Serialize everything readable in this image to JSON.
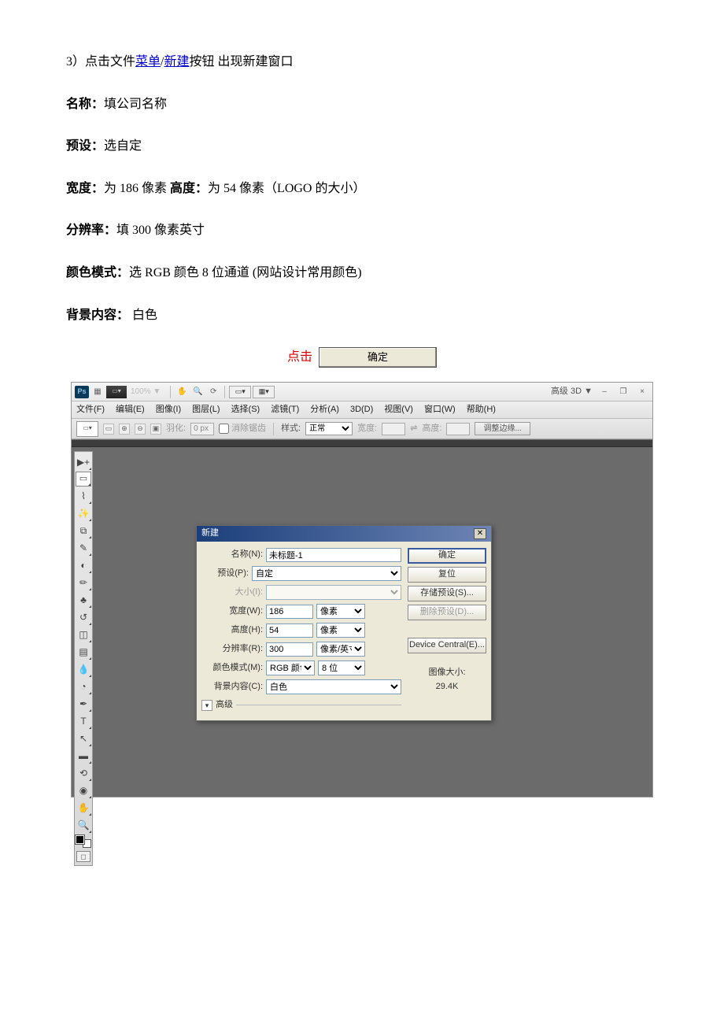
{
  "doc": {
    "step3_prefix": "3）点击文件",
    "menu_link": "菜单",
    "slash": "/",
    "new_link": "新建",
    "step3_suffix": "按钮  出现新建窗口",
    "name_label": "名称：",
    "name_value": "填公司名称",
    "preset_label": "预设：",
    "preset_value": "选自定",
    "width_label": "宽度：",
    "width_value": "为 186 像素  ",
    "height_label": "高度：",
    "height_value": "为 54 像素（LOGO 的大小）",
    "res_label": "分辨率：",
    "res_value": "填 300 像素英寸",
    "color_label": "颜色模式：",
    "color_value": "选 RGB 颜色  8 位通道  (网站设计常用颜色)",
    "bg_label": "背景内容：",
    "bg_value": "   白色",
    "click_text": "点击",
    "ok_demo_label": "确定"
  },
  "ps": {
    "logo": "Ps",
    "zoom": "100% ▼",
    "advanced_3d": "高级 3D ▼",
    "menus": [
      "文件(F)",
      "编辑(E)",
      "图像(I)",
      "图层(L)",
      "选择(S)",
      "滤镜(T)",
      "分析(A)",
      "3D(D)",
      "视图(V)",
      "窗口(W)",
      "帮助(H)"
    ],
    "options": {
      "feather_label": "羽化:",
      "feather_value": "0 px",
      "antialias_label": "消除锯齿",
      "style_label": "样式:",
      "style_value": "正常",
      "width_label": "宽度:",
      "link_icon": "⇌",
      "height_label": "高度:",
      "refine_btn": "调整边缘..."
    },
    "dialog": {
      "title": "新建",
      "name_label": "名称(N):",
      "name_value": "未标题-1",
      "preset_label": "预设(P):",
      "preset_value": "自定",
      "size_label": "大小(I):",
      "width_label": "宽度(W):",
      "width_value": "186",
      "width_unit": "像素",
      "height_label": "高度(H):",
      "height_value": "54",
      "height_unit": "像素",
      "res_label": "分辨率(R):",
      "res_value": "300",
      "res_unit": "像素/英寸",
      "color_label": "颜色模式(M):",
      "color_value": "RGB 颜色",
      "bit_value": "8 位",
      "bg_label": "背景内容(C):",
      "bg_value": "白色",
      "advanced": "高级",
      "ok_btn": "确定",
      "reset_btn": "复位",
      "save_btn": "存储预设(S)...",
      "delete_btn": "删除预设(D)...",
      "dc_btn": "Device Central(E)...",
      "imgsize_label": "图像大小:",
      "imgsize_value": "29.4K"
    }
  }
}
